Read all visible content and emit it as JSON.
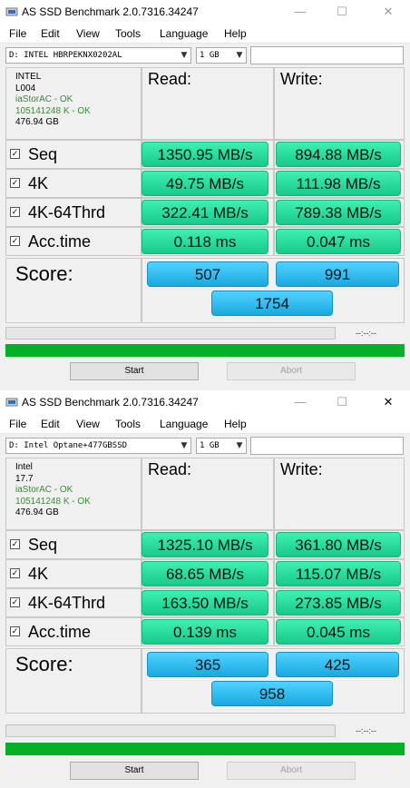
{
  "windows": [
    {
      "title": "AS SSD Benchmark 2.0.7316.34247",
      "menu": [
        "File",
        "Edit",
        "View",
        "Tools",
        "Language",
        "Help"
      ],
      "drive_select": "D: INTEL HBRPEKNX0202AL",
      "size_select": "1 GB",
      "info": {
        "model": "INTEL",
        "firmware": "L004",
        "driver": "iaStorAC - OK",
        "alignment": "105141248 K - OK",
        "capacity": "476.94 GB"
      },
      "read_header": "Read:",
      "write_header": "Write:",
      "rows": [
        {
          "label": "Seq",
          "read": "1350.95 MB/s",
          "write": "894.88 MB/s"
        },
        {
          "label": "4K",
          "read": "49.75 MB/s",
          "write": "111.98 MB/s"
        },
        {
          "label": "4K-64Thrd",
          "read": "322.41 MB/s",
          "write": "789.38 MB/s"
        },
        {
          "label": "Acc.time",
          "read": "0.118 ms",
          "write": "0.047 ms"
        }
      ],
      "score_label": "Score:",
      "score_read": "507",
      "score_write": "991",
      "score_total": "1754",
      "time_display": "--:--:--",
      "start_label": "Start",
      "abort_label": "Abort"
    },
    {
      "title": "AS SSD Benchmark 2.0.7316.34247",
      "menu": [
        "File",
        "Edit",
        "View",
        "Tools",
        "Language",
        "Help"
      ],
      "drive_select": "D: Intel Optane+477GBSSD",
      "size_select": "1 GB",
      "info": {
        "model": "Intel",
        "firmware": "17.7",
        "driver": "iaStorAC - OK",
        "alignment": "105141248 K - OK",
        "capacity": "476.94 GB"
      },
      "read_header": "Read:",
      "write_header": "Write:",
      "rows": [
        {
          "label": "Seq",
          "read": "1325.10 MB/s",
          "write": "361.80 MB/s"
        },
        {
          "label": "4K",
          "read": "68.65 MB/s",
          "write": "115.07 MB/s"
        },
        {
          "label": "4K-64Thrd",
          "read": "163.50 MB/s",
          "write": "273.85 MB/s"
        },
        {
          "label": "Acc.time",
          "read": "0.139 ms",
          "write": "0.045 ms"
        }
      ],
      "score_label": "Score:",
      "score_read": "365",
      "score_write": "425",
      "score_total": "958",
      "time_display": "--:--:--",
      "start_label": "Start",
      "abort_label": "Abort"
    }
  ],
  "colors": {
    "result_green": "#2fe3a0",
    "score_blue": "#2bbcf0",
    "progress_green": "#06b025"
  },
  "icons": [
    "app-icon",
    "minimize-icon",
    "maximize-icon",
    "close-icon",
    "dropdown-arrow-icon",
    "checkbox-checked-icon"
  ]
}
